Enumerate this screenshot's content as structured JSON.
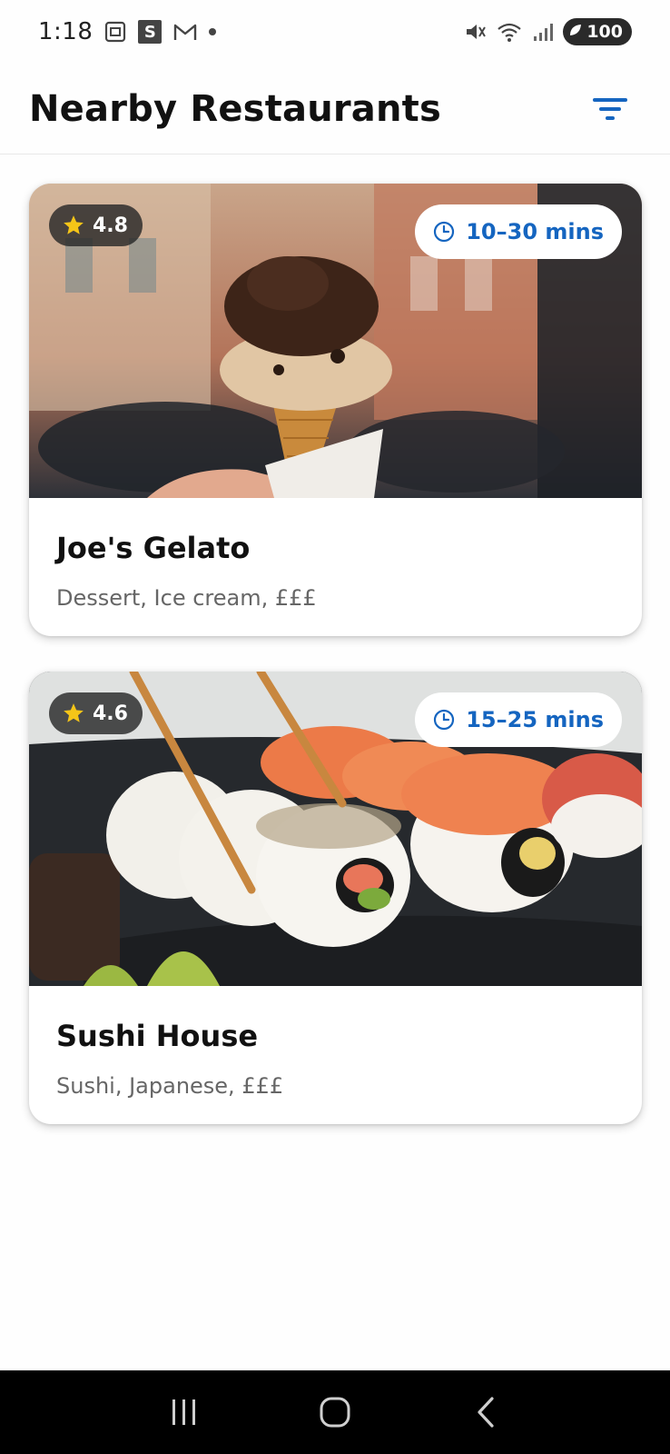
{
  "status_bar": {
    "time": "1:18",
    "s_label": "S",
    "battery": "100"
  },
  "header": {
    "title": "Nearby Restaurants",
    "filter_icon": "filter-icon"
  },
  "restaurants": [
    {
      "name": "Joe's Gelato",
      "meta": "Dessert, Ice cream, £££",
      "rating": "4.8",
      "delivery_time": "10–30 mins",
      "image_icon": "ice-cream-photo"
    },
    {
      "name": "Sushi House",
      "meta": "Sushi, Japanese, £££",
      "rating": "4.6",
      "delivery_time": "15–25 mins",
      "image_icon": "sushi-photo"
    }
  ],
  "colors": {
    "accent": "#1565c0",
    "star": "#f5c518",
    "navbar": "#000000"
  }
}
